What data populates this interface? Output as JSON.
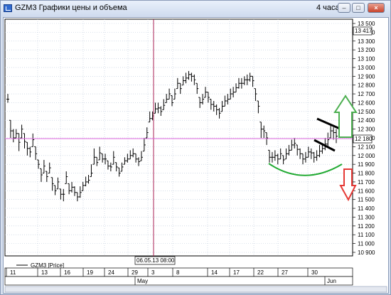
{
  "window": {
    "title": "GZM3 Графики цены и объема",
    "interval": "4 часа",
    "minimize_glyph": "–",
    "maximize_glyph": "□",
    "close_glyph": "×",
    "icon": "chart-window-icon"
  },
  "legend": {
    "label": "GZM3 [Price]"
  },
  "crosshair": {
    "date_label": "06.05.13 08:00",
    "price_label": "13 417"
  },
  "last_price": {
    "label": "12 180",
    "value": 12180
  },
  "price_axis": {
    "ticks": [
      "13 500",
      "13 400",
      "13 300",
      "13 200",
      "13 100",
      "13 000",
      "12 900",
      "12 800",
      "12 700",
      "12 600",
      "12 500",
      "12 400",
      "12 300",
      "12 200",
      "12 100",
      "12 000",
      "11 900",
      "11 800",
      "11 700",
      "11 600",
      "11 500",
      "11 400",
      "11 300",
      "11 200",
      "11 100",
      "11 000",
      "10 900"
    ],
    "min": 10900,
    "max": 13500
  },
  "date_axis": {
    "days": [
      "11",
      "13",
      "16",
      "19",
      "24",
      "29",
      "3",
      "8",
      "14",
      "17",
      "22",
      "27",
      "30"
    ],
    "months": [
      "May",
      "Jun"
    ]
  },
  "annotations": {
    "up_arrow_color": "#4caf50",
    "down_arrow_color": "#e53935",
    "arc_color": "#22aa33",
    "flag_color": "#000000"
  },
  "chart_data": {
    "type": "ohlc",
    "title": "",
    "ylim": [
      10900,
      13500
    ],
    "grid": true,
    "closes": [
      12640,
      12280,
      12200,
      12250,
      12150,
      12300,
      12160,
      12080,
      12040,
      12180,
      12020,
      11900,
      11780,
      11880,
      11760,
      11860,
      11680,
      11600,
      11700,
      11560,
      11560,
      11760,
      11600,
      11640,
      11580,
      11530,
      11580,
      11660,
      11700,
      11720,
      11800,
      11980,
      11920,
      12030,
      11960,
      11960,
      11880,
      11870,
      11980,
      11870,
      11800,
      11870,
      11940,
      11960,
      12000,
      12020,
      11960,
      11930,
      11980,
      12120,
      12260,
      12420,
      12450,
      12530,
      12540,
      12500,
      12570,
      12640,
      12700,
      12600,
      12700,
      12820,
      12760,
      12850,
      12880,
      12920,
      12900,
      12860,
      12760,
      12600,
      12640,
      12720,
      12660,
      12580,
      12560,
      12520,
      12480,
      12560,
      12620,
      12640,
      12700,
      12720,
      12770,
      12820,
      12820,
      12860,
      12860,
      12900,
      12850,
      12700,
      12560,
      12300,
      12280,
      12200,
      11980,
      11980,
      12000,
      11960,
      12020,
      11950,
      12020,
      12060,
      12120,
      12140,
      12070,
      12020,
      11960,
      11980,
      12040,
      12030,
      11980,
      12000,
      12050,
      12080,
      12130,
      12180,
      12280,
      12260,
      12220
    ],
    "ranges": [
      [
        12600,
        12700
      ],
      [
        12200,
        12400
      ],
      [
        12150,
        12300
      ],
      [
        12200,
        12300
      ],
      [
        12050,
        12250
      ],
      [
        12200,
        12350
      ],
      [
        12080,
        12250
      ],
      [
        12000,
        12150
      ],
      [
        11980,
        12100
      ],
      [
        12100,
        12250
      ],
      [
        11950,
        12100
      ],
      [
        11850,
        11950
      ],
      [
        11700,
        11850
      ],
      [
        11800,
        11950
      ],
      [
        11700,
        11820
      ],
      [
        11800,
        11920
      ],
      [
        11600,
        11750
      ],
      [
        11550,
        11660
      ],
      [
        11620,
        11750
      ],
      [
        11500,
        11620
      ],
      [
        11480,
        11620
      ],
      [
        11680,
        11820
      ],
      [
        11560,
        11680
      ],
      [
        11580,
        11700
      ],
      [
        11540,
        11650
      ],
      [
        11480,
        11580
      ],
      [
        11520,
        11650
      ],
      [
        11600,
        11700
      ],
      [
        11650,
        11760
      ],
      [
        11680,
        11780
      ],
      [
        11760,
        11900
      ],
      [
        11900,
        12080
      ],
      [
        11880,
        11980
      ],
      [
        11950,
        12100
      ],
      [
        11920,
        12020
      ],
      [
        11900,
        12020
      ],
      [
        11840,
        11940
      ],
      [
        11820,
        11920
      ],
      [
        11900,
        12050
      ],
      [
        11820,
        11920
      ],
      [
        11760,
        11860
      ],
      [
        11820,
        11920
      ],
      [
        11900,
        11980
      ],
      [
        11920,
        12020
      ],
      [
        11960,
        12060
      ],
      [
        11980,
        12080
      ],
      [
        11920,
        12020
      ],
      [
        11880,
        11980
      ],
      [
        11940,
        12050
      ],
      [
        12050,
        12200
      ],
      [
        12200,
        12320
      ],
      [
        12380,
        12500
      ],
      [
        12400,
        12500
      ],
      [
        12480,
        12600
      ],
      [
        12480,
        12600
      ],
      [
        12450,
        12560
      ],
      [
        12520,
        12640
      ],
      [
        12600,
        12700
      ],
      [
        12640,
        12760
      ],
      [
        12560,
        12680
      ],
      [
        12640,
        12760
      ],
      [
        12760,
        12880
      ],
      [
        12700,
        12820
      ],
      [
        12800,
        12900
      ],
      [
        12820,
        12940
      ],
      [
        12860,
        12960
      ],
      [
        12840,
        12940
      ],
      [
        12800,
        12920
      ],
      [
        12700,
        12820
      ],
      [
        12540,
        12660
      ],
      [
        12580,
        12700
      ],
      [
        12660,
        12780
      ],
      [
        12600,
        12720
      ],
      [
        12520,
        12640
      ],
      [
        12500,
        12620
      ],
      [
        12460,
        12580
      ],
      [
        12420,
        12540
      ],
      [
        12500,
        12620
      ],
      [
        12560,
        12680
      ],
      [
        12580,
        12700
      ],
      [
        12640,
        12760
      ],
      [
        12660,
        12780
      ],
      [
        12720,
        12820
      ],
      [
        12760,
        12880
      ],
      [
        12760,
        12880
      ],
      [
        12800,
        12900
      ],
      [
        12800,
        12920
      ],
      [
        12840,
        12940
      ],
      [
        12780,
        12900
      ],
      [
        12620,
        12760
      ],
      [
        12480,
        12620
      ],
      [
        12200,
        12380
      ],
      [
        12200,
        12340
      ],
      [
        12120,
        12260
      ],
      [
        11920,
        12060
      ],
      [
        11920,
        12040
      ],
      [
        11940,
        12060
      ],
      [
        11900,
        12020
      ],
      [
        11960,
        12080
      ],
      [
        11900,
        12000
      ],
      [
        11960,
        12080
      ],
      [
        12000,
        12120
      ],
      [
        12060,
        12180
      ],
      [
        12080,
        12200
      ],
      [
        12000,
        12120
      ],
      [
        11960,
        12080
      ],
      [
        11900,
        12020
      ],
      [
        11920,
        12040
      ],
      [
        11980,
        12100
      ],
      [
        11960,
        12080
      ],
      [
        11920,
        12040
      ],
      [
        11940,
        12060
      ],
      [
        11980,
        12120
      ],
      [
        12020,
        12140
      ],
      [
        12060,
        12200
      ],
      [
        12100,
        12260
      ],
      [
        12200,
        12340
      ],
      [
        12180,
        12320
      ],
      [
        12140,
        12300
      ]
    ]
  }
}
